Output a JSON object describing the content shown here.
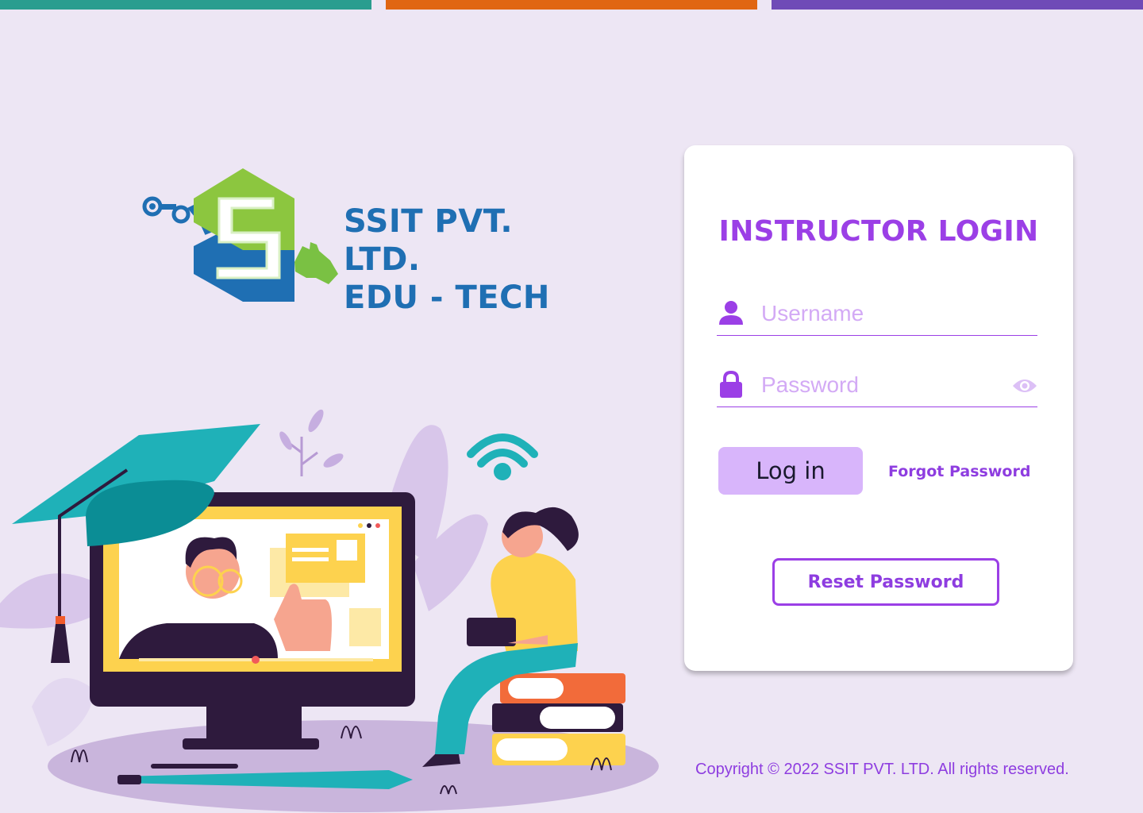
{
  "top_bars": {
    "colors": [
      "#2a9d8f",
      "#e06612",
      "#6f4bb7"
    ]
  },
  "logo": {
    "line1": "SSIT PVT. LTD.",
    "line2": "EDU - TECH",
    "brand_colors": {
      "green": "#8cc63f",
      "blue": "#1f6fb3"
    }
  },
  "login_card": {
    "title": "INSTRUCTOR LOGIN",
    "username": {
      "placeholder": "Username",
      "value": "",
      "icon": "user-icon"
    },
    "password": {
      "placeholder": "Password",
      "value": "",
      "icon": "lock-icon",
      "toggle_icon": "eye-icon"
    },
    "login_label": "Log in",
    "forgot_label": "Forgot Password",
    "reset_label": "Reset Password"
  },
  "footer": {
    "copyright": "Copyright © 2022 SSIT PVT. LTD. All rights reserved."
  },
  "theme": {
    "background": "#ede6f4",
    "accent": "#9b3fe6",
    "button_fill": "#d8b5fb"
  }
}
